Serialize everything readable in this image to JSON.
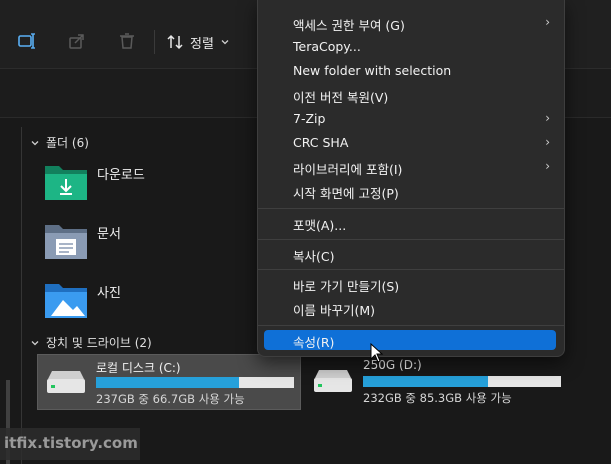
{
  "toolbar": {
    "sort_label": "정렬"
  },
  "sections": {
    "folders_label": "폴더 (6)",
    "drives_label": "장치 및 드라이브 (2)"
  },
  "folders": [
    {
      "label": "다운로드",
      "icon": "download-folder-icon"
    },
    {
      "label": "문서",
      "icon": "documents-folder-icon"
    },
    {
      "label": "사진",
      "icon": "pictures-folder-icon"
    }
  ],
  "drives": [
    {
      "name": "로컬 디스크 (C:)",
      "free": "237GB 중 66.7GB 사용 가능",
      "used_fraction": 0.72,
      "selected": true
    },
    {
      "name": "250G (D:)",
      "free": "232GB 중 85.3GB 사용 가능",
      "used_fraction": 0.63,
      "selected": false
    }
  ],
  "context_menu": {
    "items": [
      {
        "label": "액세스 권한 부여 (G)",
        "submenu": true
      },
      {
        "label": "TeraCopy...",
        "submenu": false
      },
      {
        "label": "New folder with selection",
        "submenu": false
      },
      {
        "label": "이전 버전 복원(V)",
        "submenu": false
      },
      {
        "label": "7-Zip",
        "submenu": true
      },
      {
        "label": "CRC SHA",
        "submenu": true
      },
      {
        "label": "라이브러리에 포함(I)",
        "submenu": true
      },
      {
        "label": "시작 화면에 고정(P)",
        "submenu": false
      },
      {
        "label": "포맷(A)...",
        "submenu": false
      },
      {
        "label": "복사(C)",
        "submenu": false
      },
      {
        "label": "바로 가기 만들기(S)",
        "submenu": false
      },
      {
        "label": "이름 바꾸기(M)",
        "submenu": false
      },
      {
        "label": "속성(R)",
        "submenu": false,
        "highlighted": true
      }
    ],
    "submenu_arrow": "›"
  },
  "watermark": "itfix.tistory.com",
  "colors": {
    "accent": "#0f70d7",
    "usage_bar": "#26a0da",
    "folder_teal": "#1aa57a",
    "folder_blue": "#2b8fe0"
  }
}
